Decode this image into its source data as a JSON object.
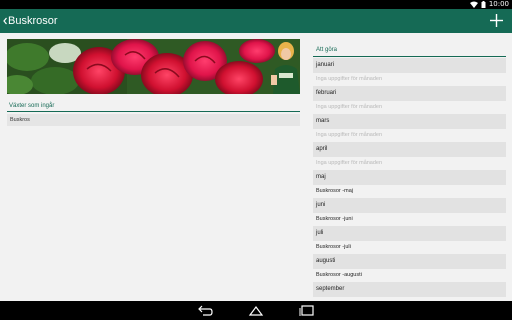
{
  "status": {
    "time": "10:00"
  },
  "app": {
    "title": "Buskrosor"
  },
  "plants": {
    "header": "Växter som ingår",
    "items": [
      "Buskros"
    ]
  },
  "todo": {
    "header": "Att göra",
    "months": [
      {
        "label": "januari",
        "note": "Inga uppgifter för månaden",
        "empty": true
      },
      {
        "label": "februari",
        "note": "Inga uppgifter för månaden",
        "empty": true
      },
      {
        "label": "mars",
        "note": "Inga uppgifter för månaden",
        "empty": true
      },
      {
        "label": "april",
        "note": "Inga uppgifter för månaden",
        "empty": true
      },
      {
        "label": "maj",
        "note": "Buskrosor -maj",
        "empty": false
      },
      {
        "label": "juni",
        "note": "Buskrosor -juni",
        "empty": false
      },
      {
        "label": "juli",
        "note": "Buskrosor -juli",
        "empty": false
      },
      {
        "label": "augusti",
        "note": "Buskrosor -augusti",
        "empty": false
      },
      {
        "label": "september",
        "note": "",
        "empty": true
      }
    ]
  },
  "colors": {
    "accent": "#156a55",
    "row_bg": "#e2e2e2",
    "page_bg": "#f2f2f2"
  },
  "icons": [
    "wifi-icon",
    "battery-icon",
    "back-icon",
    "add-icon",
    "nav-back-icon",
    "nav-home-icon",
    "nav-recents-icon"
  ]
}
